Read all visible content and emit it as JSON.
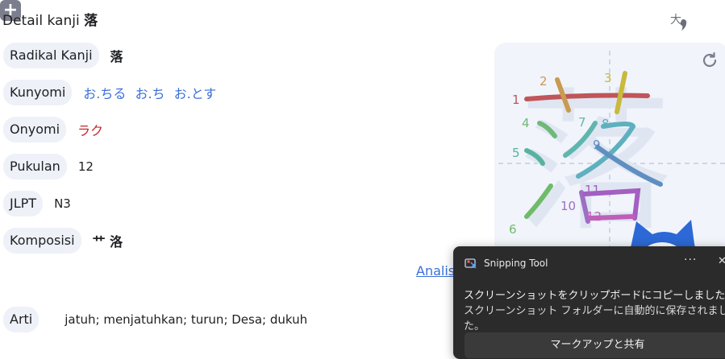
{
  "header": {
    "title_prefix": "Detail kanji ",
    "title_kanji": "落",
    "size_icon": "text-size-icon",
    "add_icon": "add-icon",
    "add_label": "+"
  },
  "details": [
    {
      "label": "Radikal Kanji",
      "value": "落"
    },
    {
      "label": "Kunyomi",
      "value": "お.ちる お.ち お.とす"
    },
    {
      "label": "Onyomi",
      "value": "ラク"
    },
    {
      "label": "Pukulan",
      "value": "12"
    },
    {
      "label": "JLPT",
      "value": "N3"
    },
    {
      "label": "Komposisi",
      "value": "艹 洛"
    }
  ],
  "analisa_link": "Analis",
  "meaning": {
    "label": "Arti",
    "value": "jatuh; menjatuhkan; turun; Desa; dukuh"
  },
  "stroke_panel": {
    "replay_icon": "replay-icon",
    "stroke_numbers": [
      "1",
      "2",
      "3",
      "4",
      "5",
      "6",
      "7",
      "8",
      "9",
      "10",
      "11",
      "12"
    ]
  },
  "toast": {
    "app_name": "Snipping Tool",
    "more": "···",
    "close": "✕",
    "line1": "スクリーンショットをクリップボードにコピーしました",
    "line2": "スクリーンショット フォルダーに自動的に保存されました。",
    "button": "マークアップと共有"
  },
  "colors": {
    "accent_blue": "#3b6fd8",
    "onyomi_red": "#c62828",
    "pill_bg": "#eef1f8",
    "toast_bg": "#2b2b2b"
  }
}
